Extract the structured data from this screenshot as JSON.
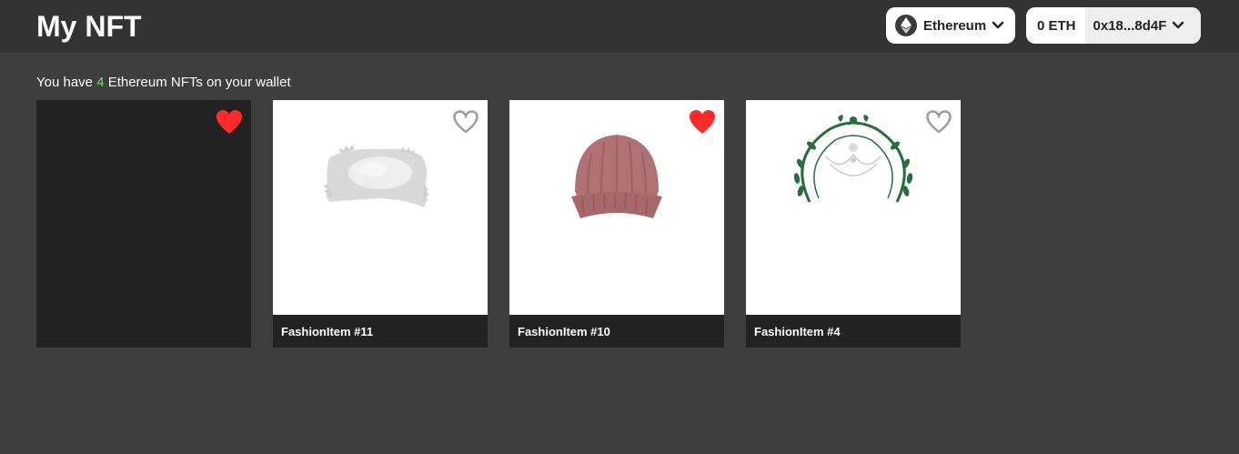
{
  "header": {
    "title": "My NFT",
    "network": {
      "label": "Ethereum",
      "icon": "ethereum-logo-icon"
    },
    "wallet": {
      "balance": "0 ETH",
      "address": "0x18...8d4F"
    }
  },
  "summary": {
    "prefix": "You have ",
    "count": "4",
    "suffix": " Ethereum NFTs on your wallet"
  },
  "colors": {
    "background": "#3e3e3e",
    "header": "#333333",
    "card": "#222222",
    "accent_count": "#7ee05a",
    "heart_liked": "#ff2a2a",
    "heart_unliked": "#9e9e9e"
  },
  "nfts": [
    {
      "name": "",
      "liked": true,
      "image": "blank-dark"
    },
    {
      "name": "FashionItem #11",
      "liked": false,
      "image": "fur-hat-icon"
    },
    {
      "name": "FashionItem #10",
      "liked": true,
      "image": "beanie-icon"
    },
    {
      "name": "FashionItem #4",
      "liked": false,
      "image": "tiara-icon"
    }
  ]
}
